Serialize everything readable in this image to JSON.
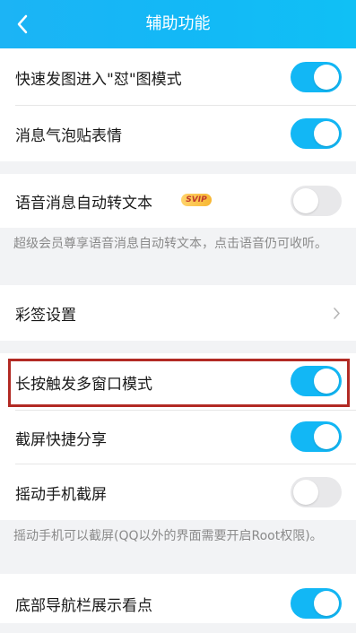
{
  "header": {
    "title": "辅助功能"
  },
  "items": {
    "fast_send": {
      "label": "快速发图进入\"怼\"图模式",
      "on": true
    },
    "bubble_sticker": {
      "label": "消息气泡贴表情",
      "on": true
    },
    "voice_to_text": {
      "label": "语音消息自动转文本",
      "badge": "SVIP",
      "on": false
    },
    "color_sign": {
      "label": "彩签设置"
    },
    "long_press_multiwindow": {
      "label": "长按触发多窗口模式",
      "on": true
    },
    "screenshot_share": {
      "label": "截屏快捷分享",
      "on": true
    },
    "shake_screenshot": {
      "label": "摇动手机截屏",
      "on": false
    },
    "bottom_nav_kandian": {
      "label": "底部导航栏展示看点",
      "on": true
    }
  },
  "notes": {
    "voice_note": "超级会员尊享语音消息自动转文本，点击语音仍可收听。",
    "shake_note": "摇动手机可以截屏(QQ以外的界面需要开启Root权限)。"
  },
  "colors": {
    "accent": "#12b7f5",
    "highlight_border": "#b22a24"
  },
  "icons": {
    "back": "chevron-left-icon",
    "arrow": "chevron-right-icon"
  }
}
